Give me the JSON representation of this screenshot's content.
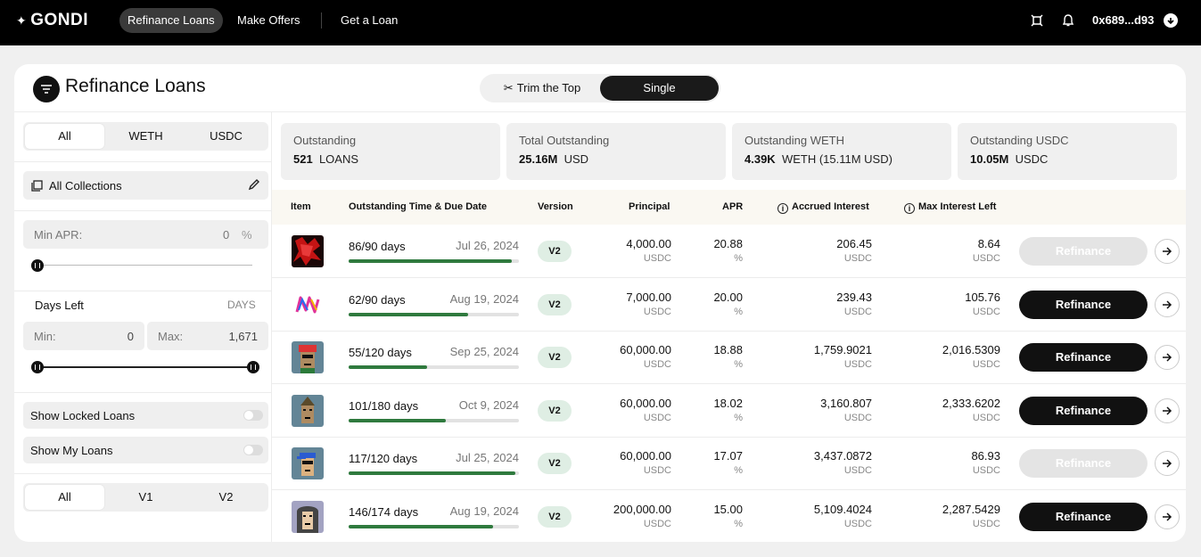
{
  "nav": {
    "logo": "GONDI",
    "tabs": [
      "Refinance Loans",
      "Make Offers",
      "Get a Loan"
    ],
    "wallet": "0x689...d93"
  },
  "header": {
    "title": "Refinance Loans",
    "toggle_options": [
      "Trim the Top",
      "Single"
    ],
    "toggle_active": "Single"
  },
  "sidebar": {
    "currency_options": [
      "All",
      "WETH",
      "USDC"
    ],
    "collections_label": "All Collections",
    "min_apr": {
      "label": "Min APR:",
      "value": "0",
      "unit": "%"
    },
    "days_left": {
      "label": "Days Left",
      "unit": "DAYS",
      "min_label": "Min:",
      "min_value": "0",
      "max_label": "Max:",
      "max_value": "1,671"
    },
    "show_locked": "Show Locked Loans",
    "show_my": "Show My Loans",
    "version_options": [
      "All",
      "V1",
      "V2"
    ]
  },
  "stats": [
    {
      "label": "Outstanding",
      "value": "521",
      "unit": "LOANS"
    },
    {
      "label": "Total Outstanding",
      "value": "25.16M",
      "unit": "USD"
    },
    {
      "label": "Outstanding WETH",
      "value": "4.39K",
      "unit": "WETH (15.11M USD)"
    },
    {
      "label": "Outstanding USDC",
      "value": "10.05M",
      "unit": "USDC"
    }
  ],
  "table": {
    "headers": {
      "item": "Item",
      "time": "Outstanding Time & Due Date",
      "version": "Version",
      "principal": "Principal",
      "apr": "APR",
      "accrued": "Accrued Interest",
      "max_left": "Max Interest Left"
    },
    "button_label": "Refinance",
    "rows": [
      {
        "days": "86/90 days",
        "due": "Jul 26, 2024",
        "progress": 0.96,
        "version": "V2",
        "principal": "4,000.00",
        "principal_unit": "USDC",
        "apr": "20.88",
        "apr_unit": "%",
        "accrued": "206.45",
        "accrued_unit": "USDC",
        "max_left": "8.64",
        "max_unit": "USDC",
        "enabled": false,
        "thumb": "red"
      },
      {
        "days": "62/90 days",
        "due": "Aug 19, 2024",
        "progress": 0.7,
        "version": "V2",
        "principal": "7,000.00",
        "principal_unit": "USDC",
        "apr": "20.00",
        "apr_unit": "%",
        "accrued": "239.43",
        "accrued_unit": "USDC",
        "max_left": "105.76",
        "max_unit": "USDC",
        "enabled": true,
        "thumb": "logo"
      },
      {
        "days": "55/120 days",
        "due": "Sep 25, 2024",
        "progress": 0.46,
        "version": "V2",
        "principal": "60,000.00",
        "principal_unit": "USDC",
        "apr": "18.88",
        "apr_unit": "%",
        "accrued": "1,759.9021",
        "accrued_unit": "USDC",
        "max_left": "2,016.5309",
        "max_unit": "USDC",
        "enabled": true,
        "thumb": "punk-red"
      },
      {
        "days": "101/180 days",
        "due": "Oct 9, 2024",
        "progress": 0.57,
        "version": "V2",
        "principal": "60,000.00",
        "principal_unit": "USDC",
        "apr": "18.02",
        "apr_unit": "%",
        "accrued": "3,160.807",
        "accrued_unit": "USDC",
        "max_left": "2,333.6202",
        "max_unit": "USDC",
        "enabled": true,
        "thumb": "punk-hat"
      },
      {
        "days": "117/120 days",
        "due": "Jul 25, 2024",
        "progress": 0.98,
        "version": "V2",
        "principal": "60,000.00",
        "principal_unit": "USDC",
        "apr": "17.07",
        "apr_unit": "%",
        "accrued": "3,437.0872",
        "accrued_unit": "USDC",
        "max_left": "86.93",
        "max_unit": "USDC",
        "enabled": false,
        "thumb": "punk-cap"
      },
      {
        "days": "146/174 days",
        "due": "Aug 19, 2024",
        "progress": 0.85,
        "version": "V2",
        "principal": "200,000.00",
        "principal_unit": "USDC",
        "apr": "15.00",
        "apr_unit": "%",
        "accrued": "5,109.4024",
        "accrued_unit": "USDC",
        "max_left": "2,287.5429",
        "max_unit": "USDC",
        "enabled": true,
        "thumb": "punk-hood"
      }
    ]
  }
}
